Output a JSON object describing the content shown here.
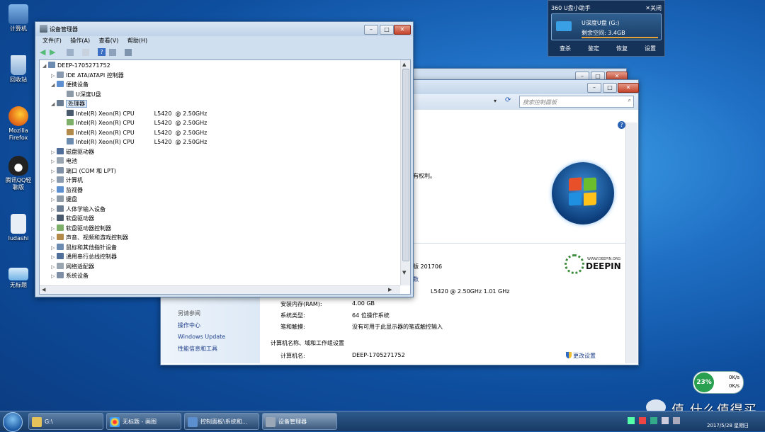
{
  "desktop": {
    "icons": [
      {
        "label": "计算机",
        "color": "#3b6fb0"
      },
      {
        "label": "回收站",
        "color": "#8ab0d8"
      },
      {
        "label": "Mozilla Firefox",
        "color": "#e8741c"
      },
      {
        "label": "腾讯QQ轻聊版",
        "color": "#222222"
      },
      {
        "label": "ludashi",
        "color": "#e8eef5"
      },
      {
        "label": "无标题",
        "color": "#6fb2e6"
      }
    ]
  },
  "usb_helper": {
    "title": "360 U盘小助手",
    "close_label": "关闭",
    "drive_name": "U深度U盘 (G:)",
    "free_space": "剩余空间: 3.4GB",
    "actions": [
      "查杀",
      "鉴定",
      "恢复",
      "设置"
    ]
  },
  "device_manager": {
    "title": "设备管理器",
    "menu": [
      "文件(F)",
      "操作(A)",
      "查看(V)",
      "帮助(H)"
    ],
    "tree": {
      "root": "DEEP-1705271752",
      "items": [
        {
          "label": "IDE ATA/ATAPI 控制器",
          "level": 1,
          "expanded": false
        },
        {
          "label": "便携设备",
          "level": 1,
          "expanded": true
        },
        {
          "label": "U深度U盘",
          "level": 2,
          "expanded": false
        },
        {
          "label": "处理器",
          "level": 1,
          "expanded": true,
          "selected": true
        },
        {
          "label": "Intel(R) Xeon(R) CPU           L5420  @ 2.50GHz",
          "level": 2,
          "expanded": false
        },
        {
          "label": "Intel(R) Xeon(R) CPU           L5420  @ 2.50GHz",
          "level": 2,
          "expanded": false
        },
        {
          "label": "Intel(R) Xeon(R) CPU           L5420  @ 2.50GHz",
          "level": 2,
          "expanded": false
        },
        {
          "label": "Intel(R) Xeon(R) CPU           L5420  @ 2.50GHz",
          "level": 2,
          "expanded": false
        },
        {
          "label": "磁盘驱动器",
          "level": 1,
          "expanded": false
        },
        {
          "label": "电池",
          "level": 1,
          "expanded": false
        },
        {
          "label": "端口 (COM 和 LPT)",
          "level": 1,
          "expanded": false
        },
        {
          "label": "计算机",
          "level": 1,
          "expanded": false
        },
        {
          "label": "监视器",
          "level": 1,
          "expanded": false
        },
        {
          "label": "键盘",
          "level": 1,
          "expanded": false
        },
        {
          "label": "人体学输入设备",
          "level": 1,
          "expanded": false
        },
        {
          "label": "软盘驱动器",
          "level": 1,
          "expanded": false
        },
        {
          "label": "软盘驱动器控制器",
          "level": 1,
          "expanded": false
        },
        {
          "label": "声音、视频和游戏控制器",
          "level": 1,
          "expanded": false
        },
        {
          "label": "鼠标和其他指针设备",
          "level": 1,
          "expanded": false
        },
        {
          "label": "通用串行总线控制器",
          "level": 1,
          "expanded": false
        },
        {
          "label": "网络适配器",
          "level": 1,
          "expanded": false
        },
        {
          "label": "系统设备",
          "level": 1,
          "expanded": false
        }
      ]
    }
  },
  "control_panel": {
    "search_placeholder": "搜索控制面板",
    "copyright_fragment": "有权利。",
    "edition_fragment": "版 201706",
    "link_fragment": "数",
    "cpu_fragment": "L5420  @ 2.50GHz   1.01 GHz",
    "see_also_title": "另请参阅",
    "see_also": [
      "操作中心",
      "Windows Update",
      "性能信息和工具"
    ],
    "ram_label": "安装内存(RAM):",
    "ram_value": "4.00 GB",
    "systype_label": "系统类型:",
    "systype_value": "64 位操作系统",
    "pen_label": "笔和触摸:",
    "pen_value": "没有可用于此显示器的笔或触控输入",
    "section_title": "计算机名称、域和工作组设置",
    "computer_name_label": "计算机名:",
    "computer_name_value": "DEEP-1705271752",
    "change_settings": "更改设置",
    "brand": "DEEPIN",
    "brand_small": "WWW.DEEPIN.ORG"
  },
  "net_monitor": {
    "percent": "23%",
    "up": "0K/s",
    "down": "0K/s"
  },
  "taskbar": {
    "buttons": [
      "G:\\",
      "无标题 - 画图",
      "控制面板\\系统和...",
      "设备管理器"
    ],
    "clock_date": "2017/5/28 星期日"
  },
  "watermark": "值 什么值得买"
}
